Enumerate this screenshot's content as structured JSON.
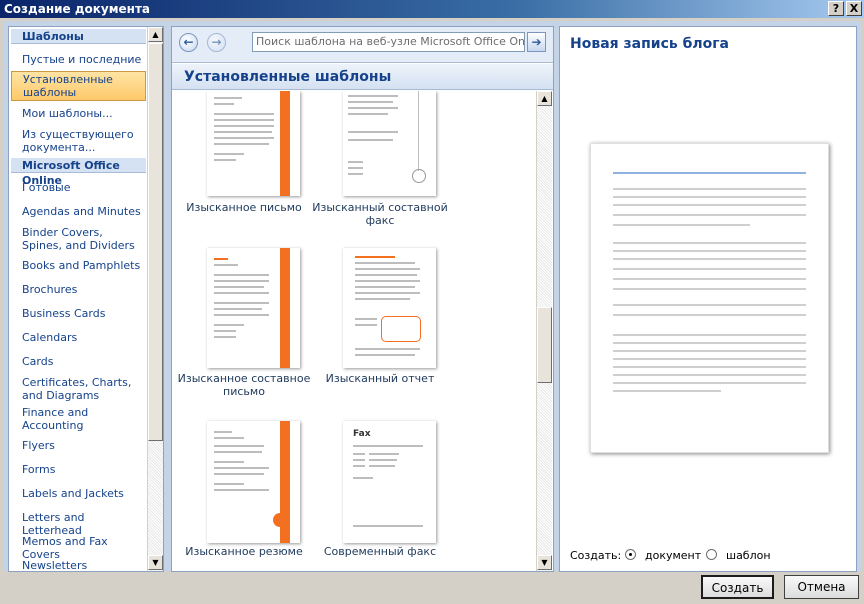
{
  "window": {
    "title": "Создание документа",
    "help_label": "?",
    "close_label": "X"
  },
  "sidebar": {
    "items": [
      {
        "label": "Шаблоны",
        "kind": "head"
      },
      {
        "label": "Пустые и последние",
        "kind": "item"
      },
      {
        "label": "Установленные шаблоны",
        "kind": "selected"
      },
      {
        "label": "Мои шаблоны...",
        "kind": "item"
      },
      {
        "label": "Из существующего документа...",
        "kind": "item"
      },
      {
        "label": "Microsoft Office Online",
        "kind": "head"
      },
      {
        "label": "Готовые",
        "kind": "item"
      },
      {
        "label": "Agendas and Minutes",
        "kind": "item"
      },
      {
        "label": "Binder Covers, Spines, and Dividers",
        "kind": "item"
      },
      {
        "label": "Books and Pamphlets",
        "kind": "item"
      },
      {
        "label": "Brochures",
        "kind": "item"
      },
      {
        "label": "Business Cards",
        "kind": "item"
      },
      {
        "label": "Calendars",
        "kind": "item"
      },
      {
        "label": "Cards",
        "kind": "item"
      },
      {
        "label": "Certificates, Charts, and Diagrams",
        "kind": "item"
      },
      {
        "label": "Finance and Accounting",
        "kind": "item"
      },
      {
        "label": "Flyers",
        "kind": "item"
      },
      {
        "label": "Forms",
        "kind": "item"
      },
      {
        "label": "Labels and Jackets",
        "kind": "item"
      },
      {
        "label": "Letters and Letterhead",
        "kind": "item"
      },
      {
        "label": "Memos and Fax Covers",
        "kind": "item"
      },
      {
        "label": "Newsletters",
        "kind": "item"
      }
    ]
  },
  "search": {
    "placeholder": "Поиск шаблона на веб-узле Microsoft Office Online",
    "back_icon": "arrow-left-icon",
    "forward_icon": "arrow-right-icon",
    "go_icon": "arrow-go-icon"
  },
  "gallery": {
    "heading": "Установленные шаблоны",
    "templates": [
      {
        "label": "Изысканное письмо"
      },
      {
        "label": "Изысканный составной факс"
      },
      {
        "label": "Изысканное составное письмо"
      },
      {
        "label": "Изысканный отчет"
      },
      {
        "label": "Изысканное резюме"
      },
      {
        "label": "Современный факс"
      }
    ],
    "fax_thumb_text": "Fax"
  },
  "preview": {
    "title": "Новая запись блога",
    "create_label": "Создать:",
    "option_document": "документ",
    "option_template": "шаблон",
    "selected_option": "документ"
  },
  "buttons": {
    "create": "Создать",
    "cancel": "Отмена"
  },
  "colors": {
    "accent": "#f37021",
    "selected_bg": "#ffc96a",
    "header_text": "#15428b"
  }
}
